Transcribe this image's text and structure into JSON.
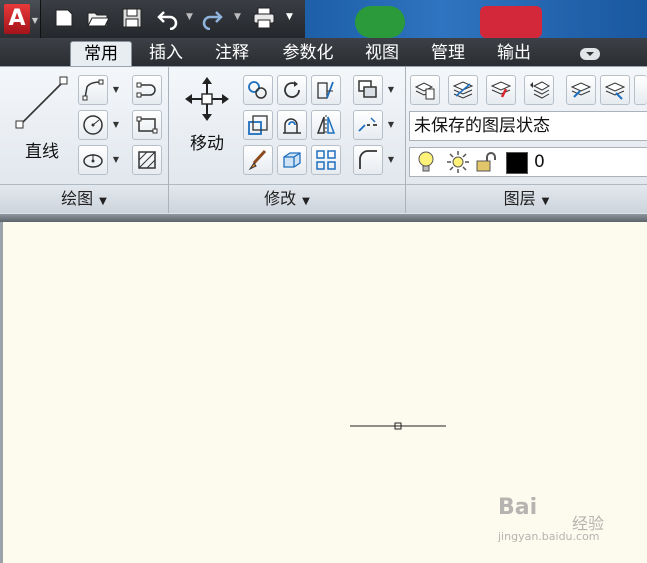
{
  "ribbon_tabs": [
    {
      "label": "常用",
      "active": true
    },
    {
      "label": "插入"
    },
    {
      "label": "注释"
    },
    {
      "label": "参数化"
    },
    {
      "label": "视图"
    },
    {
      "label": "管理"
    },
    {
      "label": "输出"
    }
  ],
  "panels": {
    "draw": {
      "label": "绘图",
      "line_label": "直线"
    },
    "modify": {
      "label": "修改",
      "move_label": "移动"
    },
    "layers": {
      "label": "图层",
      "layer_state": "未保存的图层状态",
      "current_layer": "0"
    }
  },
  "watermark": {
    "brand": "Bai",
    "brand_suffix": "经验",
    "url": "jingyan.baidu.com"
  },
  "colors": {
    "accent_red": "#d9272e",
    "ribbon_bg": "#e6ebf0",
    "canvas_bg": "#fdfaee"
  }
}
